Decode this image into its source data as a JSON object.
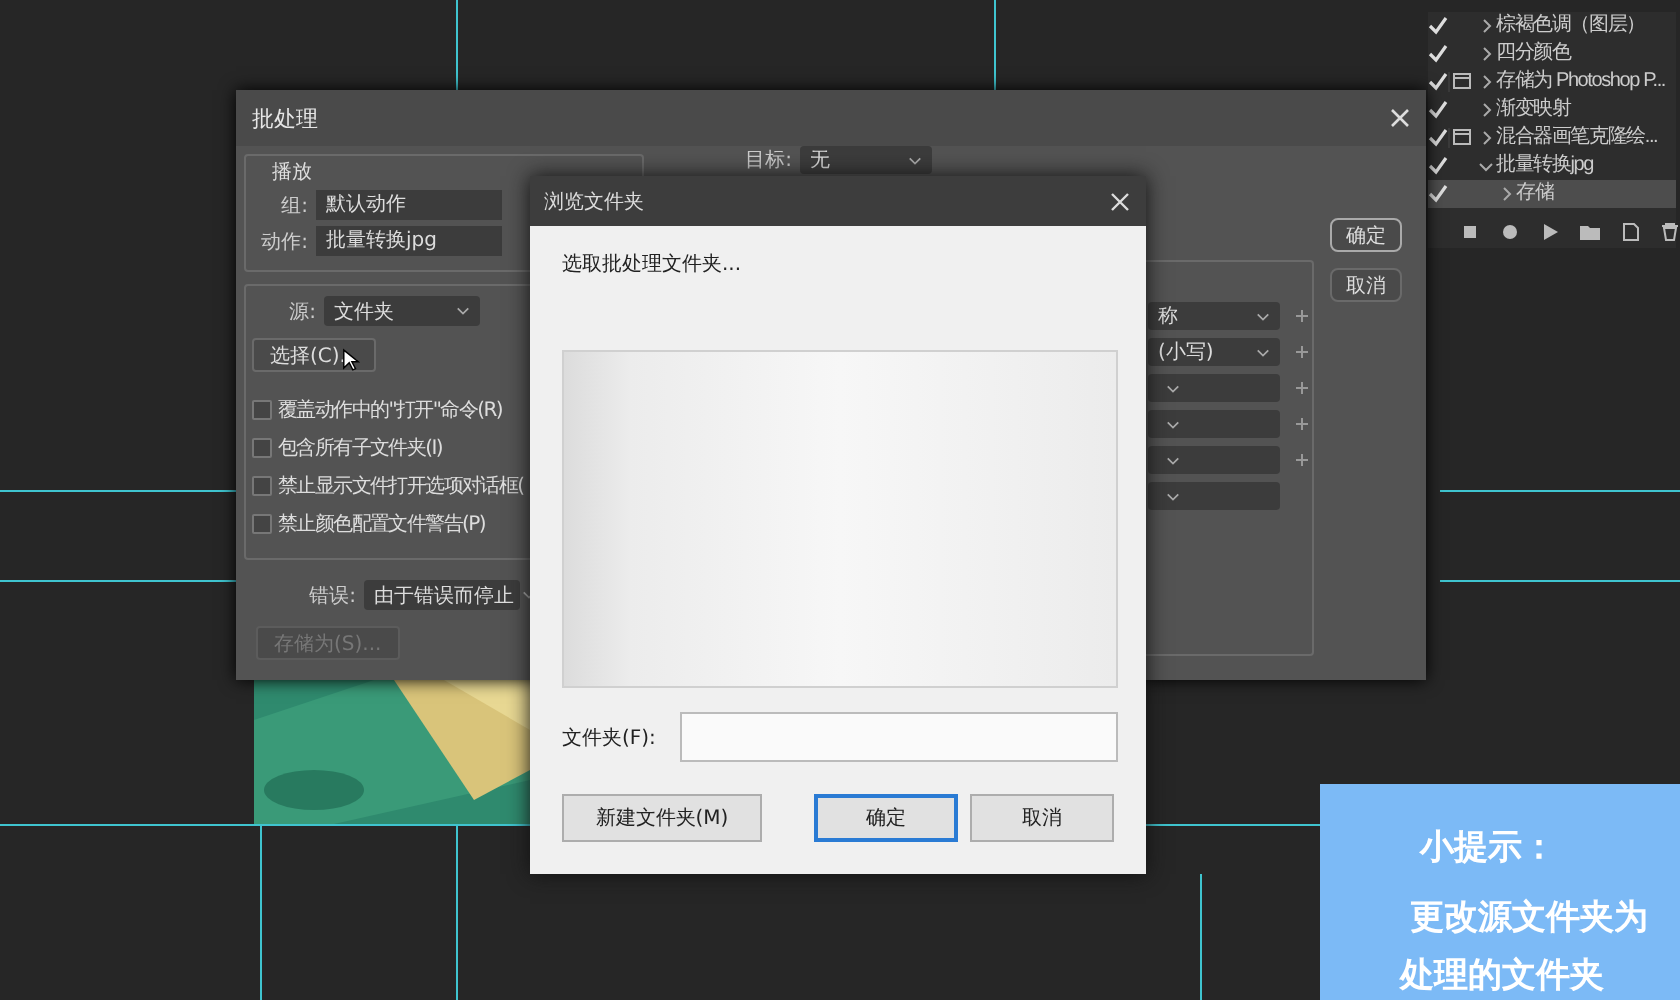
{
  "actions_panel": {
    "items": [
      {
        "label": "棕褐色调（图层）",
        "checked": true,
        "dialog": false,
        "expanded": false
      },
      {
        "label": "四分颜色",
        "checked": true,
        "dialog": false,
        "expanded": false
      },
      {
        "label": "存储为 Photoshop P...",
        "checked": true,
        "dialog": true,
        "expanded": false
      },
      {
        "label": "渐变映射",
        "checked": true,
        "dialog": false,
        "expanded": false
      },
      {
        "label": "混合器画笔克隆绘...",
        "checked": true,
        "dialog": true,
        "expanded": false
      },
      {
        "label": "批量转换jpg",
        "checked": true,
        "dialog": false,
        "expanded": true,
        "children": [
          {
            "label": "存储",
            "checked": true,
            "selected": true
          }
        ]
      }
    ]
  },
  "batch_dialog": {
    "title": "批处理",
    "play_legend": "播放",
    "group_label": "组:",
    "group_value": "默认动作",
    "action_label": "动作:",
    "action_value": "批量转换jpg",
    "target_label": "目标:",
    "target_value": "无",
    "source_label": "源:",
    "source_value": "文件夹",
    "choose_button": "选择(C)...",
    "options": [
      {
        "label": "覆盖动作中的\"打开\"命令(R)",
        "checked": false
      },
      {
        "label": "包含所有子文件夹(I)",
        "checked": false
      },
      {
        "label": "禁止显示文件打开选项对话框(",
        "checked": false
      },
      {
        "label": "禁止颜色配置文件警告(P)",
        "checked": false
      }
    ],
    "error_label": "错误:",
    "error_value": "由于错误而停止",
    "save_button": {
      "label": "存储为(S)...",
      "disabled": true
    },
    "naming_rows": [
      {
        "value": "称",
        "plus": true
      },
      {
        "value": "(小写)",
        "plus": true
      },
      {
        "plus": true
      },
      {
        "plus": true
      },
      {
        "plus": true
      },
      {
        "plus": false
      }
    ],
    "buttons": [
      {
        "label": "确定",
        "default": true
      },
      {
        "label": "取消",
        "default": false
      }
    ]
  },
  "browse_dialog": {
    "title": "浏览文件夹",
    "prompt": "选取批处理文件夹...",
    "folder_label": "文件夹(F):",
    "buttons": [
      {
        "label": "新建文件夹(M)",
        "default": false
      },
      {
        "label": "确定",
        "default": true
      },
      {
        "label": "取消",
        "default": false
      }
    ]
  },
  "tip": {
    "title": "小提示：",
    "lines": [
      "更改源文件夹为",
      "处理的文件夹"
    ]
  }
}
